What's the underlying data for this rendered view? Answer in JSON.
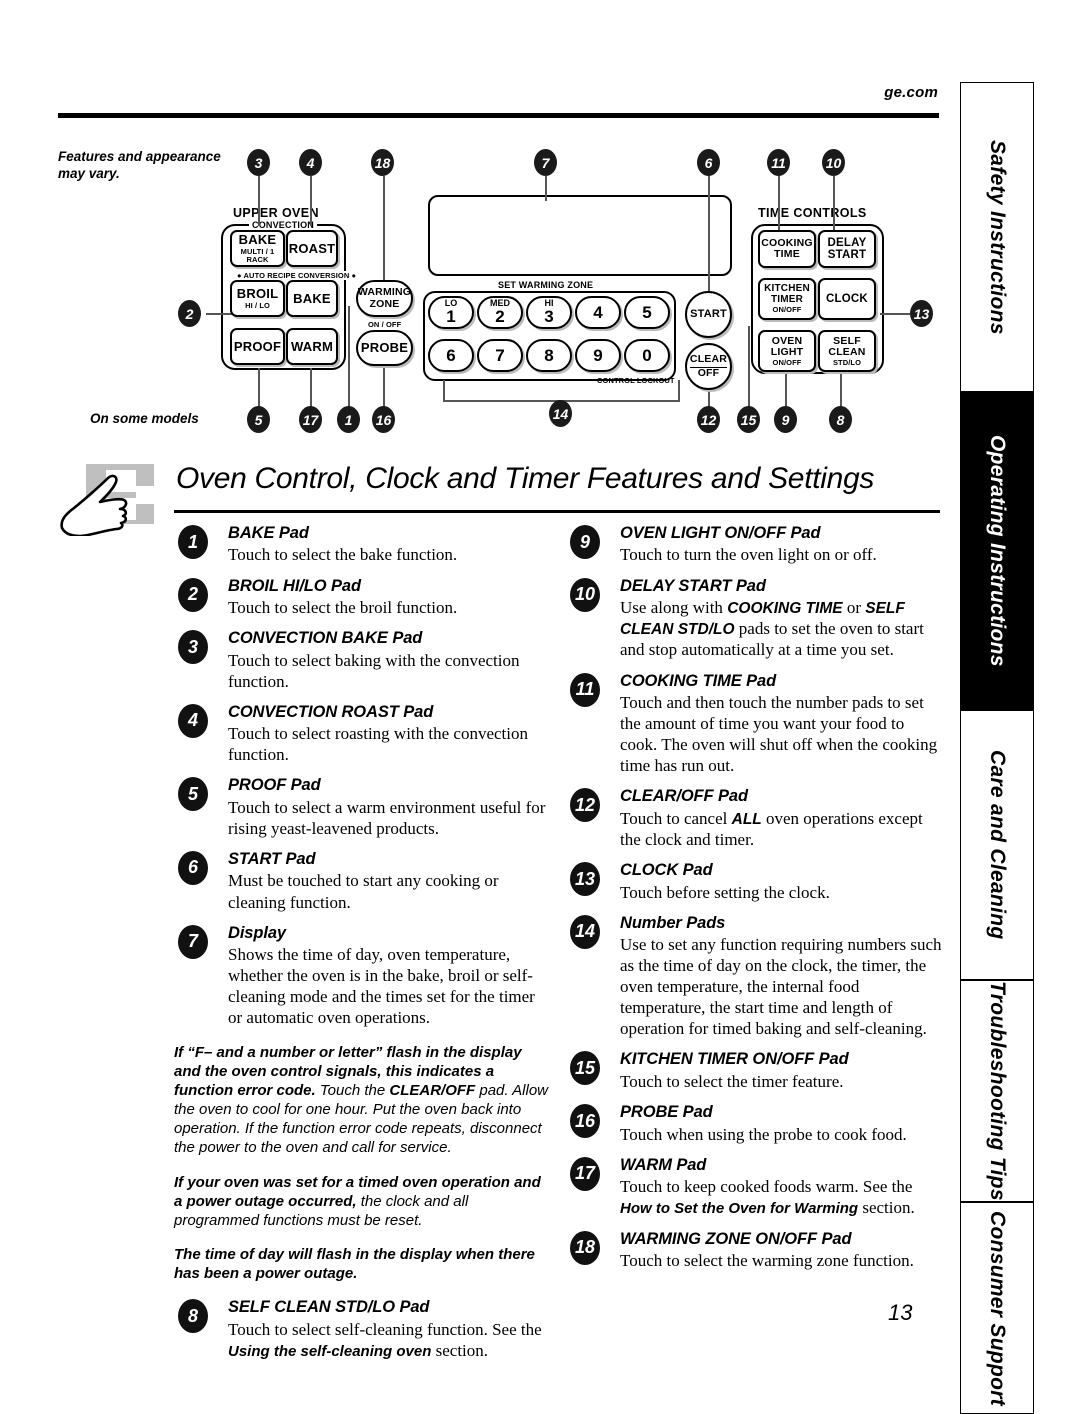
{
  "header": {
    "site": "ge.com"
  },
  "sidebar": {
    "tabs": [
      {
        "label": "Safety Instructions",
        "active": false
      },
      {
        "label": "Operating Instructions",
        "active": true
      },
      {
        "label": "Care and Cleaning",
        "active": false
      },
      {
        "label": "Troubleshooting Tips",
        "active": false
      },
      {
        "label": "Consumer Support",
        "active": false
      }
    ]
  },
  "diagram": {
    "note_vary": "Features and appearance may vary.",
    "note_models": "On some models",
    "labels": {
      "upper_oven": "UPPER OVEN",
      "convection": "CONVECTION",
      "auto_recipe": "● AUTO RECIPE CONVERSION ●",
      "on_off": "ON / OFF",
      "set_warming_zone": "SET WARMING ZONE",
      "control_lockout": "CONTROL LOCKOUT",
      "time_controls": "TIME CONTROLS"
    },
    "keys": {
      "conv_bake": {
        "line1": "BAKE",
        "line2": "MULTI / 1 RACK"
      },
      "conv_roast": {
        "line1": "ROAST"
      },
      "broil": {
        "line1": "BROIL",
        "line2": "HI / LO"
      },
      "bake": {
        "line1": "BAKE"
      },
      "proof": {
        "line1": "PROOF"
      },
      "warm": {
        "line1": "WARM"
      },
      "warming_zone": {
        "line1": "WARMING",
        "line2": "ZONE"
      },
      "probe": {
        "line1": "PROBE"
      },
      "start": {
        "line1": "START"
      },
      "clear_off": {
        "line1": "CLEAR",
        "line2": "OFF"
      },
      "cooking_time": {
        "line1": "COOKING",
        "line2": "TIME"
      },
      "delay_start": {
        "line1": "DELAY",
        "line2": "START"
      },
      "kitchen_timer": {
        "line1": "KITCHEN",
        "line2": "TIMER",
        "line3": "ON/OFF"
      },
      "clock": {
        "line1": "CLOCK"
      },
      "oven_light": {
        "line1": "OVEN",
        "line2": "LIGHT",
        "line3": "ON/OFF"
      },
      "self_clean": {
        "line1": "SELF",
        "line2": "CLEAN",
        "line3": "STD/LO"
      }
    },
    "numpad_row1": [
      {
        "top": "LO",
        "num": "1"
      },
      {
        "top": "MED",
        "num": "2"
      },
      {
        "top": "HI",
        "num": "3"
      },
      {
        "top": "",
        "num": "4"
      },
      {
        "top": "",
        "num": "5"
      }
    ],
    "numpad_row2": [
      {
        "top": "",
        "num": "6"
      },
      {
        "top": "",
        "num": "7"
      },
      {
        "top": "",
        "num": "8"
      },
      {
        "top": "",
        "num": "9"
      },
      {
        "top": "",
        "num": "0"
      }
    ],
    "callouts": {
      "c1": "1",
      "c2": "2",
      "c3": "3",
      "c4": "4",
      "c5": "5",
      "c6": "6",
      "c7": "7",
      "c8": "8",
      "c9": "9",
      "c10": "10",
      "c11": "11",
      "c12": "12",
      "c13": "13",
      "c14": "14",
      "c15": "15",
      "c16": "16",
      "c17": "17",
      "c18": "18"
    }
  },
  "page_title": "Oven Control, Clock and Timer Features and Settings",
  "page_number": "13",
  "left_column": {
    "items": [
      {
        "num": "1",
        "title": "BAKE Pad",
        "body": "Touch to select the bake function."
      },
      {
        "num": "2",
        "title": "BROIL HI/LO Pad",
        "body": "Touch to select the broil function."
      },
      {
        "num": "3",
        "title": "CONVECTION BAKE Pad",
        "body": "Touch to select baking with the convection function."
      },
      {
        "num": "4",
        "title": "CONVECTION ROAST Pad",
        "body": "Touch to select roasting with the convection function."
      },
      {
        "num": "5",
        "title": "PROOF Pad",
        "body": "Touch to select a warm environment useful for rising yeast-leavened products."
      },
      {
        "num": "6",
        "title": "START Pad",
        "body": "Must be touched to start any cooking or cleaning function."
      },
      {
        "num": "7",
        "title": "Display",
        "body": "Shows the time of day, oven temperature, whether the oven is in the bake, broil or self-cleaning mode and the times set for the timer or automatic oven operations."
      }
    ],
    "notes": [
      {
        "bold": "If “F– and a number or letter” flash in the display and the oven control signals, this indicates a function error code.",
        "regular_1": " Touch the ",
        "emph": "CLEAR/OFF",
        "regular_2": " pad. Allow the oven to cool for one hour. Put the oven back into operation. If the function error code repeats, disconnect the power to the oven and call for service."
      },
      {
        "bold": "If your oven was set for a timed oven operation and a power outage occurred,",
        "regular_1": " the clock and all programmed functions must be reset.",
        "emph": "",
        "regular_2": ""
      },
      {
        "bold": "The time of day will flash in the display when there has been a power outage.",
        "regular_1": "",
        "emph": "",
        "regular_2": ""
      }
    ],
    "item8": {
      "num": "8",
      "title": "SELF CLEAN STD/LO Pad",
      "body_1": "Touch to select self-cleaning function. See the ",
      "body_emph": "Using the self-cleaning oven",
      "body_2": " section."
    }
  },
  "right_column": {
    "items": [
      {
        "num": "9",
        "title": "OVEN LIGHT ON/OFF Pad",
        "body": "Touch to turn the oven light on or off."
      },
      {
        "num": "11",
        "title": "COOKING TIME Pad",
        "body": "Touch and then touch the number pads to set the amount of time you want your food to cook. The oven will shut off when the cooking time has run out."
      },
      {
        "num": "13",
        "title": "CLOCK Pad",
        "body": "Touch before setting the clock."
      },
      {
        "num": "14",
        "title": "Number Pads",
        "body": "Use to set any function requiring numbers such as the time of day on the clock, the timer, the oven temperature, the internal food temperature, the start time and length of operation for timed baking and self-cleaning."
      },
      {
        "num": "15",
        "title": "KITCHEN TIMER ON/OFF Pad",
        "body": "Touch to select the timer feature."
      },
      {
        "num": "16",
        "title": "PROBE Pad",
        "body": "Touch when using the probe to cook food."
      },
      {
        "num": "18",
        "title": "WARMING ZONE ON/OFF Pad",
        "body": "Touch to select the warming zone function."
      }
    ],
    "item10": {
      "num": "10",
      "title": "DELAY START Pad",
      "body_1": "Use along with ",
      "emph_1": "COOKING TIME",
      "body_2": " or ",
      "emph_2": "SELF CLEAN STD/LO",
      "body_3": " pads to set the oven to start and stop automatically at a time you set."
    },
    "item12": {
      "num": "12",
      "title": "CLEAR/OFF Pad",
      "body_1": "Touch to cancel ",
      "emph": "ALL",
      "body_2": " oven operations except the clock and timer."
    },
    "item17": {
      "num": "17",
      "title": "WARM Pad",
      "body_1": "Touch to keep cooked foods warm. See the ",
      "emph": "How to Set the Oven for Warming",
      "body_2": " section."
    }
  }
}
